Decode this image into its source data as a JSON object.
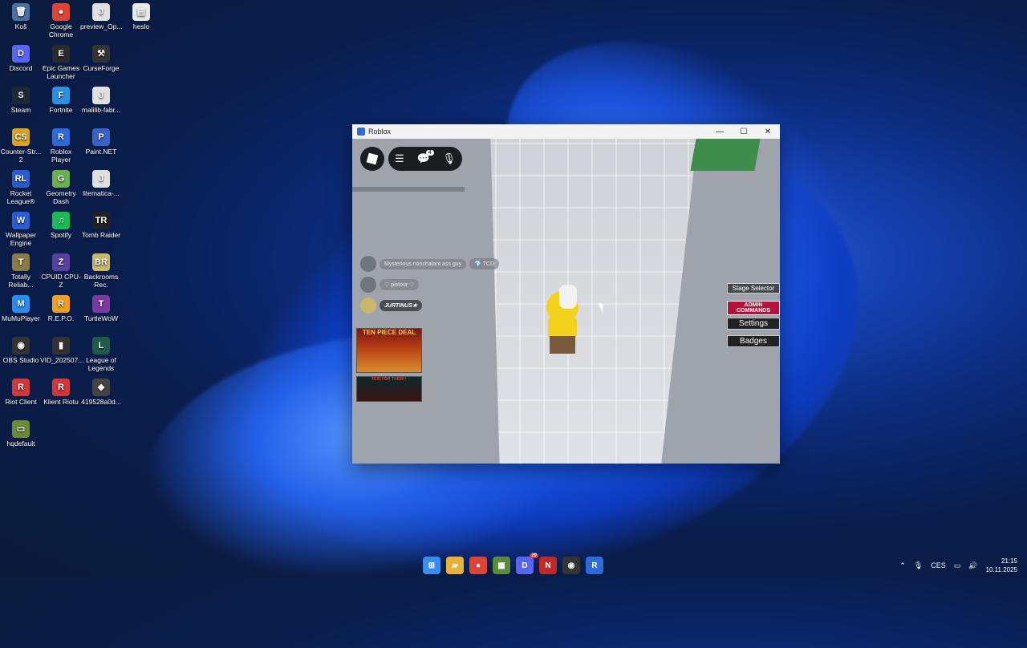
{
  "desktop": {
    "icons": [
      {
        "label": "Koš",
        "glyph": "🗑",
        "color": "#4a6fa5"
      },
      {
        "label": "Google Chrome",
        "glyph": "●",
        "color": "#db4437"
      },
      {
        "label": "preview_Op...",
        "glyph": "J",
        "color": "#e0e0e0"
      },
      {
        "label": "heslo",
        "glyph": "▤",
        "color": "#e8e8e8"
      },
      {
        "label": "Discord",
        "glyph": "D",
        "color": "#5865f2"
      },
      {
        "label": "Epic Games Launcher",
        "glyph": "E",
        "color": "#2a2a2a"
      },
      {
        "label": "CurseForge",
        "glyph": "⚒",
        "color": "#333"
      },
      {
        "label": "Steam",
        "glyph": "S",
        "color": "#1b2838"
      },
      {
        "label": "Fortnite",
        "glyph": "F",
        "color": "#2a90e0"
      },
      {
        "label": "malilib-fabr...",
        "glyph": "J",
        "color": "#e0e0e0"
      },
      {
        "label": "Counter-Str... 2",
        "glyph": "CS",
        "color": "#d9a321"
      },
      {
        "label": "Roblox Player",
        "glyph": "R",
        "color": "#2f6bd8"
      },
      {
        "label": "Paint.NET",
        "glyph": "P",
        "color": "#3a62c6"
      },
      {
        "label": "Rocket League®",
        "glyph": "RL",
        "color": "#2a5bd1"
      },
      {
        "label": "Geometry Dash",
        "glyph": "G",
        "color": "#6ab04c"
      },
      {
        "label": "litematica-...",
        "glyph": "J",
        "color": "#e0e0e0"
      },
      {
        "label": "Wallpaper Engine",
        "glyph": "W",
        "color": "#2b5cd6"
      },
      {
        "label": "Spotify",
        "glyph": "♫",
        "color": "#1db954"
      },
      {
        "label": "Tomb Raider",
        "glyph": "TR",
        "color": "#222"
      },
      {
        "label": "Totally Reliab...",
        "glyph": "T",
        "color": "#8a7a4a"
      },
      {
        "label": "CPUID CPU-Z",
        "glyph": "Z",
        "color": "#5a3fa0"
      },
      {
        "label": "Backrooms Rec.",
        "glyph": "BR",
        "color": "#c9b86a"
      },
      {
        "label": "MuMuPlayer",
        "glyph": "M",
        "color": "#2a8cf0"
      },
      {
        "label": "R.E.P.O.",
        "glyph": "R",
        "color": "#f0a020"
      },
      {
        "label": "TurtleWoW",
        "glyph": "T",
        "color": "#7a3aa0"
      },
      {
        "label": "OBS Studio",
        "glyph": "◉",
        "color": "#333"
      },
      {
        "label": "VID_202507...",
        "glyph": "▮",
        "color": "#333"
      },
      {
        "label": "League of Legends",
        "glyph": "L",
        "color": "#1f5a4a"
      },
      {
        "label": "Riot Client",
        "glyph": "R",
        "color": "#d13639"
      },
      {
        "label": "Klient Riotu",
        "glyph": "R",
        "color": "#d13639"
      },
      {
        "label": "419528a0d...",
        "glyph": "◆",
        "color": "#444"
      },
      {
        "label": "hqdefault",
        "glyph": "▭",
        "color": "#6a8a3a"
      }
    ]
  },
  "window": {
    "title": "Roblox",
    "minimize": "—",
    "maximize": "☐",
    "close": "✕"
  },
  "game": {
    "chat_badge": "4",
    "players": [
      {
        "name": "Mysterious nonchalant ass guy",
        "tag": "💎 TCD"
      },
      {
        "name": "♡ pistour ♡",
        "tag": ""
      },
      {
        "name": "JURTINUS★",
        "tag": ""
      }
    ],
    "ads": {
      "ad1": "TEN PIECE DEAL",
      "ad2": "RUN FOR THEIR!!"
    },
    "side_buttons": {
      "stage_selector": "Stage Selector",
      "admin_commands": "ADMIN COMMANDS",
      "settings": "Settings",
      "badges": "Badges"
    }
  },
  "taskbar": {
    "tray_lang": "CES",
    "time": "21:15",
    "date": "10.11.2025",
    "discord_badge": "29",
    "icons": [
      {
        "name": "windows-start",
        "color": "#3a8cf0",
        "glyph": "⊞"
      },
      {
        "name": "file-explorer",
        "color": "#e8b23a",
        "glyph": "▰"
      },
      {
        "name": "chrome",
        "color": "#db4437",
        "glyph": "●"
      },
      {
        "name": "minecraft",
        "color": "#5a8a3a",
        "glyph": "▦"
      },
      {
        "name": "discord",
        "color": "#5865f2",
        "glyph": "D"
      },
      {
        "name": "news-app",
        "color": "#c0282a",
        "glyph": "N"
      },
      {
        "name": "obs",
        "color": "#333",
        "glyph": "◉"
      },
      {
        "name": "roblox",
        "color": "#2f6bd8",
        "glyph": "R"
      }
    ]
  }
}
